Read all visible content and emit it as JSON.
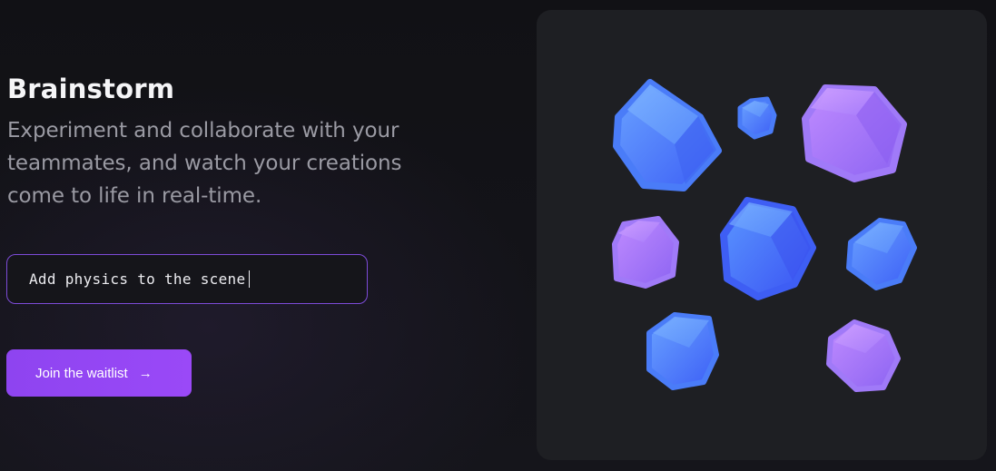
{
  "hero": {
    "title": "Brainstorm",
    "description": "Experiment and collaborate with your teammates, and watch your creations come to life in real-time."
  },
  "prompt": {
    "value": "Add physics to the scene"
  },
  "cta": {
    "label": "Join the waitlist",
    "arrow": "→"
  },
  "illustration": {
    "icon": "floating-cubes-illustration",
    "colors": {
      "panel_bg": "#1e1f23",
      "blue": "#4f7dfb",
      "light_blue": "#5b92fb",
      "purple": "#a57bfa",
      "accent_border": "#7d4bd8",
      "button": "#9347f4"
    }
  }
}
